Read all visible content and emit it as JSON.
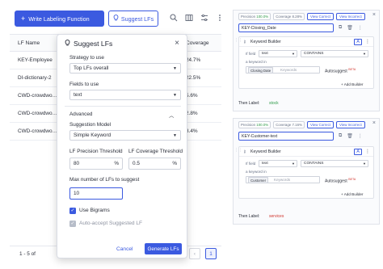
{
  "toolbar": {
    "write_label": "Write Labeling Function",
    "plus": "+",
    "suggest_label": "Suggest LFs"
  },
  "table": {
    "col_lf_name": "LF Name",
    "col_coverage": "Coverage",
    "rows": [
      {
        "name": "KEY-Employee",
        "coverage": "24.7%"
      },
      {
        "name": "DI-dictionary-2",
        "coverage": "22.5%"
      },
      {
        "name": "CWD-crowdwo…",
        "coverage": "5.6%"
      },
      {
        "name": "CWD-crowdwo…",
        "coverage": "2.8%"
      },
      {
        "name": "CWD-crowdwo…",
        "coverage": "3.4%"
      }
    ]
  },
  "pagination": {
    "info": "1 - 5 of",
    "prev": "‹",
    "page": "1"
  },
  "modal": {
    "title": "Suggest LFs",
    "close": "×",
    "strategy_label": "Strategy to use",
    "strategy_value": "Top LFs overall",
    "fields_label": "Fields to use",
    "fields_value": "text",
    "advanced_label": "Advanced",
    "model_label": "Suggestion Model",
    "model_value": "Simple Keyword",
    "precision_label": "LF Precision Threshold",
    "precision_value": "80",
    "precision_unit": "%",
    "coverage_label": "LF Coverage Threshold",
    "coverage_value": "0.5",
    "coverage_unit": "%",
    "max_label": "Max number of LFs to suggest",
    "max_value": "10",
    "bigrams_label": "Use Bigrams",
    "bigrams_checked": true,
    "autoaccept_label": "Auto-accept Suggested LF",
    "autoaccept_checked": true,
    "cancel_label": "Cancel",
    "generate_label": "Generate LFs"
  },
  "panels": [
    {
      "precision_label": "Precision",
      "precision_value": "100.0%",
      "coverage_label": "Coverage",
      "coverage_value": "8.28%",
      "view_correct": "View Correct",
      "view_incorrect": "View Incorrect",
      "name": "KEY-Closing_Date",
      "builder_title": "Keyword Builder",
      "if_field_label": "If field",
      "field_value": "text",
      "operator_value": "CONTAINS",
      "keyword_label": "a keyword in",
      "chip": "Closing Date",
      "keywords_placeholder": "Keywords",
      "autosuggest_label": "Autosuggest",
      "beta": "BETA",
      "add_builder": "+ Add Builder",
      "then_label": "Then Label:",
      "then_value": "stock",
      "then_color": "#2e9a48"
    },
    {
      "precision_label": "Precision",
      "precision_value": "100.0%",
      "coverage_label": "Coverage",
      "coverage_value": "7.16%",
      "view_correct": "View Correct",
      "view_incorrect": "View Incorrect",
      "name": "KEY-Customer-text",
      "builder_title": "Keyword Builder",
      "if_field_label": "If field",
      "field_value": "text",
      "operator_value": "CONTAINS",
      "keyword_label": "a keyword in",
      "chip": "Customer",
      "keywords_placeholder": "Keywords",
      "autosuggest_label": "Autosuggest",
      "beta": "BETA",
      "add_builder": "+ Add Builder",
      "then_label": "Then Label:",
      "then_value": "services",
      "then_color": "#d0342c"
    }
  ],
  "colors": {
    "accent": "#3b5ae0",
    "success": "#2e9a48",
    "danger": "#d0342c"
  }
}
